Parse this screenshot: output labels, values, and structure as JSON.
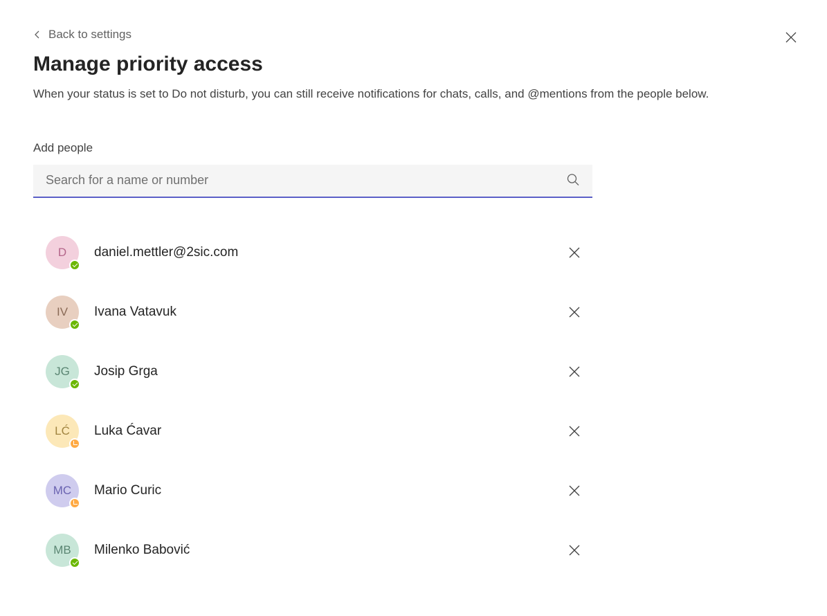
{
  "header": {
    "back_label": "Back to settings",
    "title": "Manage priority access",
    "description": "When your status is set to Do not disturb, you can still receive notifications for chats, calls, and @mentions from the people below."
  },
  "search": {
    "label": "Add people",
    "placeholder": "Search for a name or number"
  },
  "people": [
    {
      "name": "daniel.mettler@2sic.com",
      "initials": "D",
      "avatar_bg": "#f3d0dd",
      "avatar_fg": "#b4668a",
      "presence": "available"
    },
    {
      "name": "Ivana Vatavuk",
      "initials": "IV",
      "avatar_bg": "#e8cfc0",
      "avatar_fg": "#8a6a56",
      "presence": "available"
    },
    {
      "name": "Josip Grga",
      "initials": "JG",
      "avatar_bg": "#c8e6d8",
      "avatar_fg": "#5a8572",
      "presence": "available"
    },
    {
      "name": "Luka Ćavar",
      "initials": "LĆ",
      "avatar_bg": "#fce8b8",
      "avatar_fg": "#a08440",
      "presence": "away"
    },
    {
      "name": "Mario Curic",
      "initials": "MC",
      "avatar_bg": "#cfccee",
      "avatar_fg": "#6a63b0",
      "presence": "away"
    },
    {
      "name": "Milenko Babović",
      "initials": "MB",
      "avatar_bg": "#c8e6d8",
      "avatar_fg": "#5a8572",
      "presence": "available"
    }
  ]
}
